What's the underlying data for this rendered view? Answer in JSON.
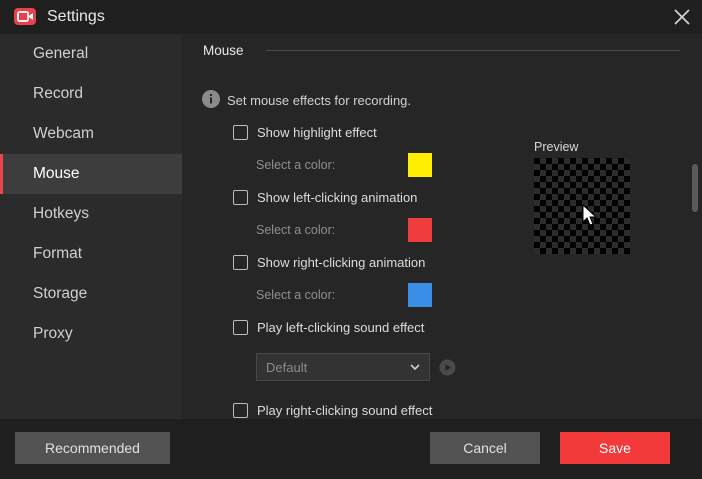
{
  "window": {
    "title": "Settings"
  },
  "sidebar": {
    "items": [
      {
        "label": "General",
        "active": false
      },
      {
        "label": "Record",
        "active": false
      },
      {
        "label": "Webcam",
        "active": false
      },
      {
        "label": "Mouse",
        "active": true
      },
      {
        "label": "Hotkeys",
        "active": false
      },
      {
        "label": "Format",
        "active": false
      },
      {
        "label": "Storage",
        "active": false
      },
      {
        "label": "Proxy",
        "active": false
      }
    ]
  },
  "content": {
    "section_title": "Mouse",
    "info_text": "Set mouse effects for recording.",
    "options": {
      "highlight": {
        "label": "Show highlight effect",
        "checked": false,
        "color_label": "Select a color:",
        "color": "#ffee00"
      },
      "left_click": {
        "label": "Show left-clicking animation",
        "checked": false,
        "color_label": "Select a color:",
        "color": "#ef3d3d"
      },
      "right_click": {
        "label": "Show right-clicking animation",
        "checked": false,
        "color_label": "Select a color:",
        "color": "#3a8ee6"
      },
      "left_sound": {
        "label": "Play left-clicking sound effect",
        "checked": false,
        "sound": "Default"
      },
      "right_sound": {
        "label": "Play right-clicking sound effect",
        "checked": false
      }
    },
    "preview_label": "Preview"
  },
  "footer": {
    "recommended_label": "Recommended",
    "cancel_label": "Cancel",
    "save_label": "Save"
  },
  "colors": {
    "accent": "#f23a3a",
    "sidebar_active": "#3d3d3d"
  },
  "icons": [
    "app-logo-icon",
    "close-icon",
    "info-icon",
    "cursor-icon",
    "chevron-down-icon",
    "play-icon"
  ]
}
